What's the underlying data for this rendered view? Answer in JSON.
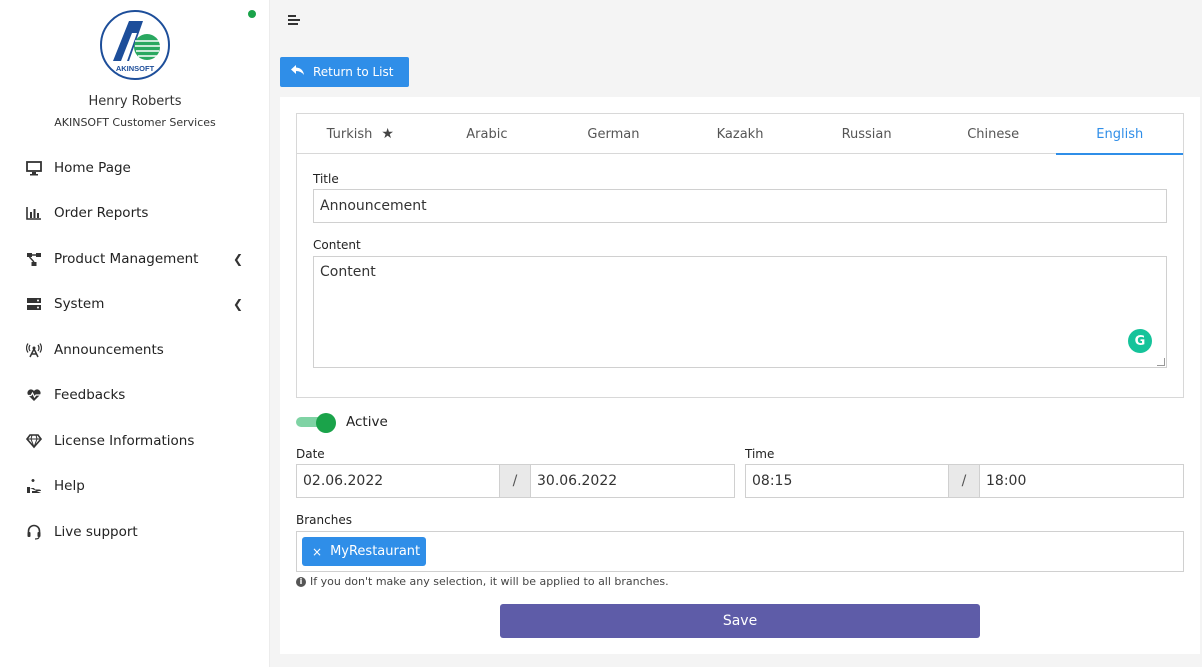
{
  "brand": {
    "logo_text": "AKINSOFT"
  },
  "user": {
    "name": "Henry Roberts",
    "role": "AKINSOFT Customer Services"
  },
  "sidebar": {
    "items": [
      {
        "label": "Home Page",
        "icon": "monitor-icon"
      },
      {
        "label": "Order Reports",
        "icon": "bar-chart-icon"
      },
      {
        "label": "Product Management",
        "icon": "sitemap-icon",
        "has_submenu": true
      },
      {
        "label": "System",
        "icon": "server-icon",
        "has_submenu": true
      },
      {
        "label": "Announcements",
        "icon": "broadcast-icon"
      },
      {
        "label": "Feedbacks",
        "icon": "heartbeat-icon"
      },
      {
        "label": "License Informations",
        "icon": "diamond-icon"
      },
      {
        "label": "Help",
        "icon": "help-hand-icon"
      },
      {
        "label": "Live support",
        "icon": "headset-icon"
      }
    ]
  },
  "toolbar": {
    "return_label": "Return to List"
  },
  "tabs": [
    {
      "label": "Turkish",
      "starred": true
    },
    {
      "label": "Arabic"
    },
    {
      "label": "German"
    },
    {
      "label": "Kazakh"
    },
    {
      "label": "Russian"
    },
    {
      "label": "Chinese"
    },
    {
      "label": "English",
      "active": true
    }
  ],
  "form": {
    "title_label": "Title",
    "title_value": "Announcement",
    "content_label": "Content",
    "content_value": "Content",
    "active_label": "Active",
    "active": true,
    "date_label": "Date",
    "date_start": "02.06.2022",
    "date_end": "30.06.2022",
    "time_label": "Time",
    "time_start": "08:15",
    "time_end": "18:00",
    "range_separator": "/",
    "branches_label": "Branches",
    "branches": [
      "MyRestaurant"
    ],
    "branches_hint": "If you don't make any selection, it will be applied to all branches.",
    "save_label": "Save"
  },
  "colors": {
    "primary": "#2f8ee8",
    "save": "#5e5ca8",
    "toggle_on": "#1aa34a",
    "online": "#1aa34a"
  }
}
